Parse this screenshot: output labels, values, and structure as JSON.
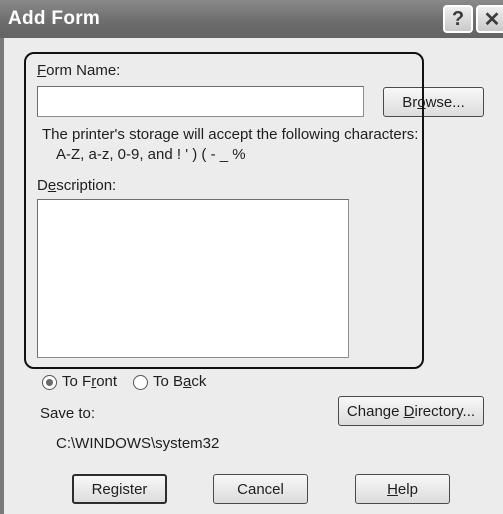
{
  "window": {
    "title": "Add Form",
    "help_glyph": "?",
    "close_glyph": "✕"
  },
  "form_name": {
    "label_prefix": "",
    "label_hotkey": "F",
    "label_rest": "orm Name:",
    "value": "",
    "browse_prefix": "Br",
    "browse_hotkey": "o",
    "browse_rest": "wse..."
  },
  "storage_note": {
    "line1": "The printer's storage will accept the following characters:",
    "line2": "A-Z, a-z, 0-9, and ! ' ) ( - _ %"
  },
  "description": {
    "label_prefix": "D",
    "label_hotkey": "e",
    "label_rest": "scription:",
    "value": ""
  },
  "placement": {
    "to_front_prefix": "To F",
    "to_front_hotkey": "r",
    "to_front_rest": "ont",
    "to_back_prefix": "To B",
    "to_back_hotkey": "a",
    "to_back_rest": "ck",
    "selected": "to_front"
  },
  "save_to": {
    "label": "Save to:",
    "path": "C:\\WINDOWS\\system32",
    "change_prefix": "Change ",
    "change_hotkey": "D",
    "change_rest": "irectory..."
  },
  "buttons": {
    "register": "Register",
    "cancel": "Cancel",
    "help_hotkey": "H",
    "help_rest": "elp"
  }
}
